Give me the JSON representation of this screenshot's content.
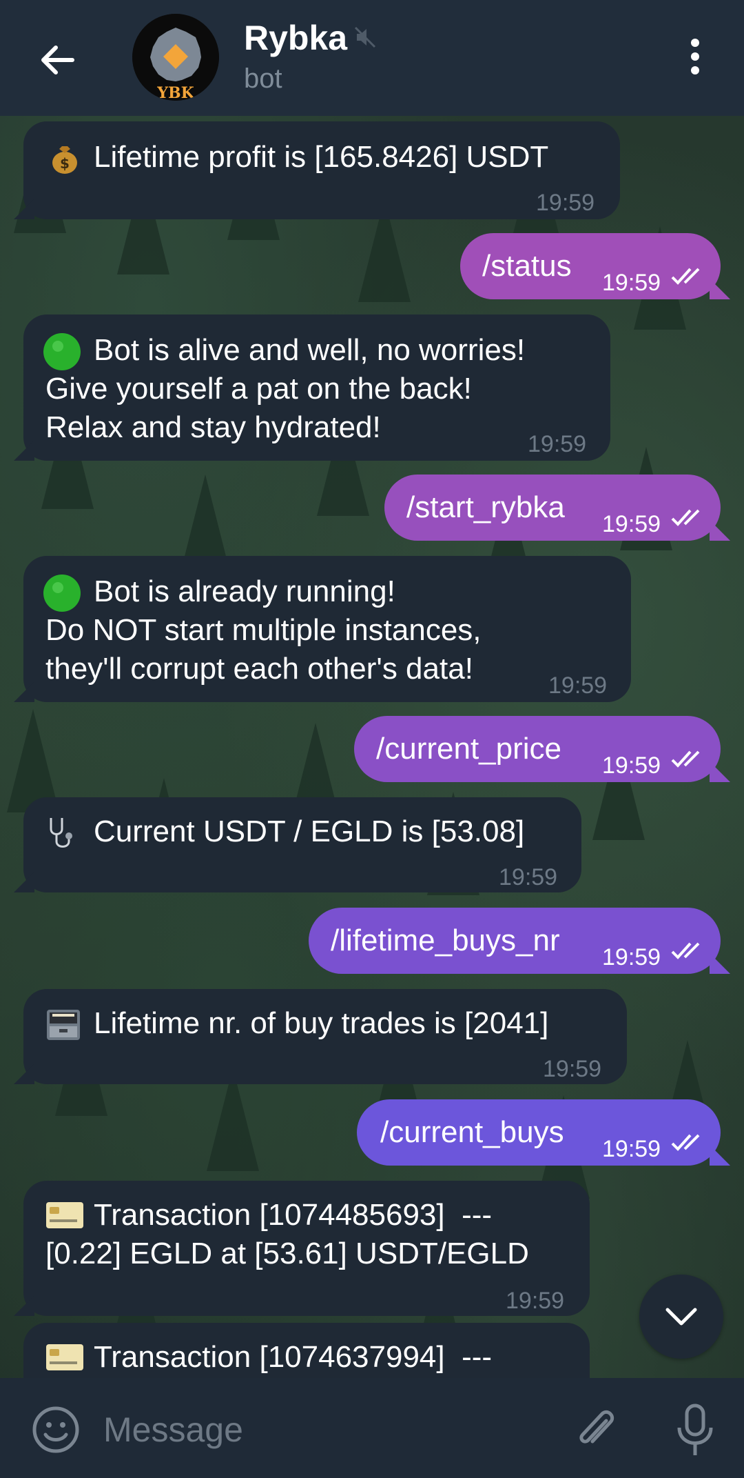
{
  "header": {
    "title": "Rybka",
    "subtitle": "bot",
    "avatar_text": "YBK"
  },
  "messages": [
    {
      "dir": "in",
      "emoji": "money-bag-icon",
      "lines": [
        "Lifetime profit is [165.8426] USDT"
      ],
      "time": "19:59"
    },
    {
      "dir": "out",
      "text": "/status",
      "time": "19:59"
    },
    {
      "dir": "in",
      "emoji": "green-circle-icon",
      "lines": [
        "Bot is alive and well, no worries!",
        "Give yourself a pat on the back!",
        "Relax and stay hydrated!"
      ],
      "time": "19:59"
    },
    {
      "dir": "out",
      "text": "/start_rybka",
      "time": "19:59"
    },
    {
      "dir": "in",
      "emoji": "green-circle-icon",
      "lines": [
        "Bot is already running!",
        "Do NOT start multiple instances,",
        "they'll corrupt each other's data!"
      ],
      "time": "19:59"
    },
    {
      "dir": "out",
      "text": "/current_price",
      "time": "19:59"
    },
    {
      "dir": "in",
      "emoji": "stethoscope-icon",
      "lines": [
        "Current USDT / EGLD is [53.08]"
      ],
      "time": "19:59"
    },
    {
      "dir": "out",
      "text": "/lifetime_buys_nr",
      "time": "19:59"
    },
    {
      "dir": "in",
      "emoji": "file-cabinet-icon",
      "lines": [
        "Lifetime nr. of buy trades is [2041]"
      ],
      "time": "19:59"
    },
    {
      "dir": "out",
      "text": "/current_buys",
      "time": "19:59"
    },
    {
      "dir": "in",
      "emoji": "credit-card-icon",
      "lines": [
        "Transaction [1074485693]  ---",
        "[0.22] EGLD at [53.61] USDT/EGLD"
      ],
      "time": "19:59"
    },
    {
      "dir": "in",
      "emoji": "credit-card-icon",
      "lines": [
        "Transaction [1074637994]  ---"
      ],
      "time": ""
    }
  ],
  "composer": {
    "placeholder": "Message"
  },
  "colors": {
    "header_bg": "#212d3b",
    "incoming_bubble": "#1f2935",
    "outgoing_gradient": [
      "#a24fb6",
      "#7b4fd3",
      "#6c56db"
    ],
    "muted_text": "#6d7986",
    "green_dot": "#2fb52f"
  }
}
